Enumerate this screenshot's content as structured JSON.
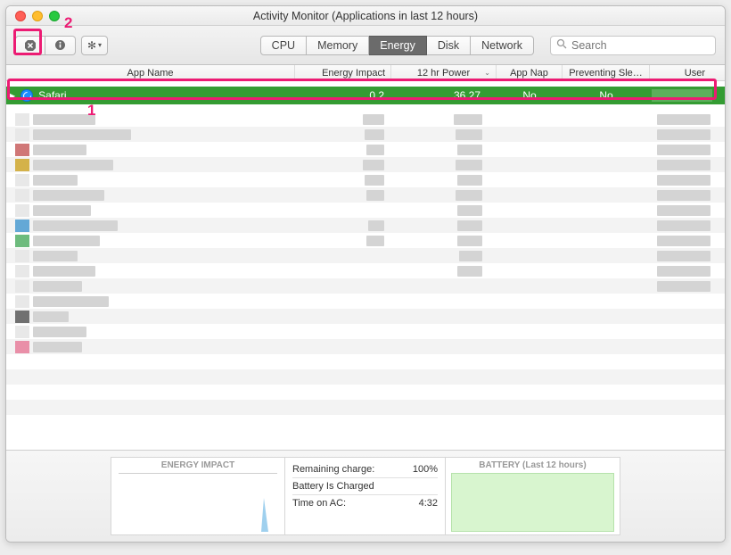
{
  "window": {
    "title": "Activity Monitor (Applications in last 12 hours)"
  },
  "tabs": {
    "cpu": "CPU",
    "memory": "Memory",
    "energy": "Energy",
    "disk": "Disk",
    "network": "Network"
  },
  "search": {
    "placeholder": "Search"
  },
  "headers": {
    "app_name": "App Name",
    "energy_impact": "Energy Impact",
    "power_12h": "12 hr Power",
    "app_nap": "App Nap",
    "preventing_sleep": "Preventing Sle…",
    "user": "User"
  },
  "rows": [
    {
      "app": "Safari",
      "energy_impact": "0.2",
      "power_12h": "36.27",
      "app_nap": "No",
      "preventing_sleep": "No"
    }
  ],
  "summary": {
    "energy_impact_label": "ENERGY IMPACT",
    "remaining_charge_label": "Remaining charge:",
    "remaining_charge_value": "100%",
    "battery_charged_label": "Battery Is Charged",
    "time_on_ac_label": "Time on AC:",
    "time_on_ac_value": "4:32",
    "battery_header": "BATTERY (Last 12 hours)"
  },
  "callouts": {
    "label1": "1",
    "label2": "2"
  }
}
